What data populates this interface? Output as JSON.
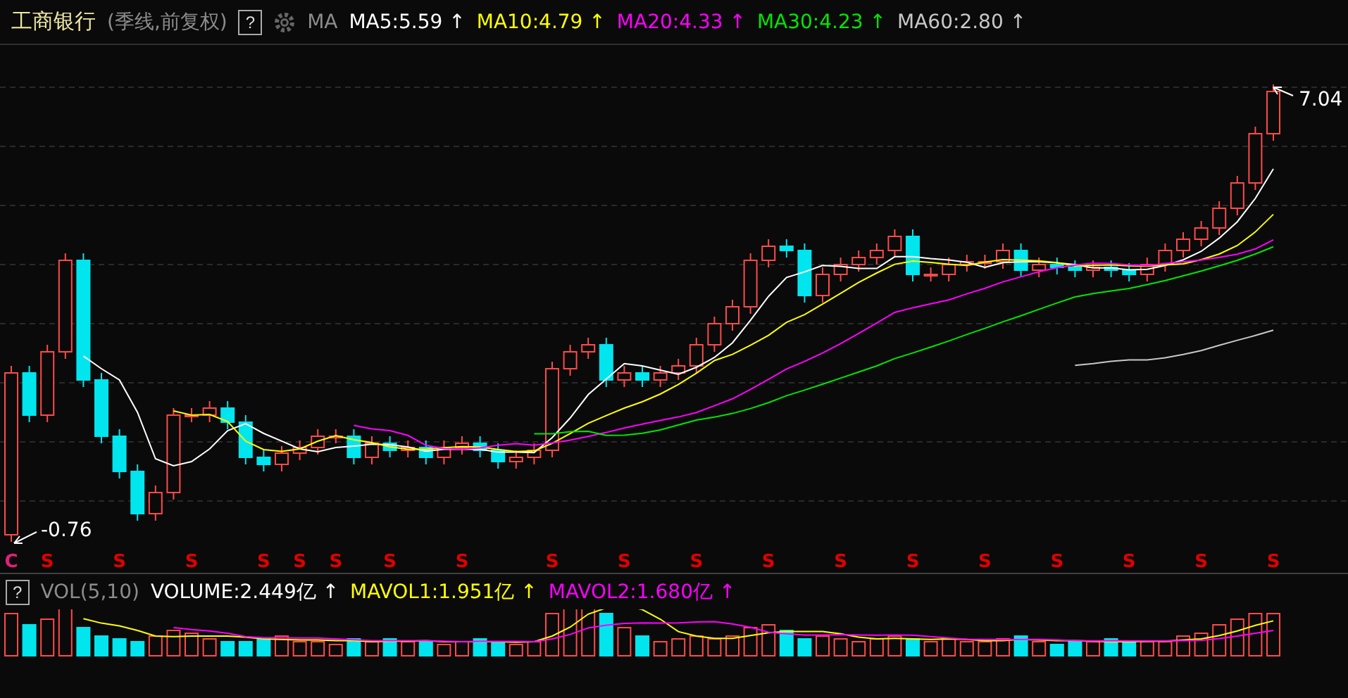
{
  "header": {
    "title": "工商银行",
    "subtitle": "(季线,前复权)",
    "help": "?",
    "indicator": "MA",
    "legend": [
      {
        "label": "MA5:5.59",
        "arrow": "↑",
        "color": "#ffffff"
      },
      {
        "label": "MA10:4.79",
        "arrow": "↑",
        "color": "#ffff00"
      },
      {
        "label": "MA20:4.33",
        "arrow": "↑",
        "color": "#ff00ff"
      },
      {
        "label": "MA30:4.23",
        "arrow": "↑",
        "color": "#00e600"
      },
      {
        "label": "MA60:2.80",
        "arrow": "↑",
        "color": "#c8c8c8"
      }
    ]
  },
  "chart": {
    "max_label": "7.04",
    "min_label": "-0.76",
    "markers": [
      {
        "label": "C",
        "color": "#e0207a"
      },
      {
        "label": "S",
        "color": "#e00000"
      },
      {
        "label": "S",
        "color": "#e00000"
      },
      {
        "label": "S",
        "color": "#e00000"
      },
      {
        "label": "S",
        "color": "#e00000"
      },
      {
        "label": "S",
        "color": "#e00000"
      },
      {
        "label": "S",
        "color": "#e00000"
      },
      {
        "label": "S",
        "color": "#e00000"
      },
      {
        "label": "S",
        "color": "#e00000"
      },
      {
        "label": "S",
        "color": "#e00000"
      },
      {
        "label": "S",
        "color": "#e00000"
      },
      {
        "label": "S",
        "color": "#e00000"
      },
      {
        "label": "S",
        "color": "#e00000"
      },
      {
        "label": "S",
        "color": "#e00000"
      },
      {
        "label": "S",
        "color": "#e00000"
      },
      {
        "label": "S",
        "color": "#e00000"
      },
      {
        "label": "S",
        "color": "#e00000"
      },
      {
        "label": "S",
        "color": "#e00000"
      },
      {
        "label": "S",
        "color": "#e00000"
      },
      {
        "label": "S",
        "color": "#e00000"
      }
    ]
  },
  "volume": {
    "help": "?",
    "indicator": "VOL(5,10)",
    "legend": [
      {
        "label": "VOLUME:2.449亿",
        "arrow": "↑",
        "color": "#ffffff"
      },
      {
        "label": "MAVOL1:1.951亿",
        "arrow": "↑",
        "color": "#ffff00"
      },
      {
        "label": "MAVOL2:1.680亿",
        "arrow": "↑",
        "color": "#ff00ff"
      }
    ]
  }
}
